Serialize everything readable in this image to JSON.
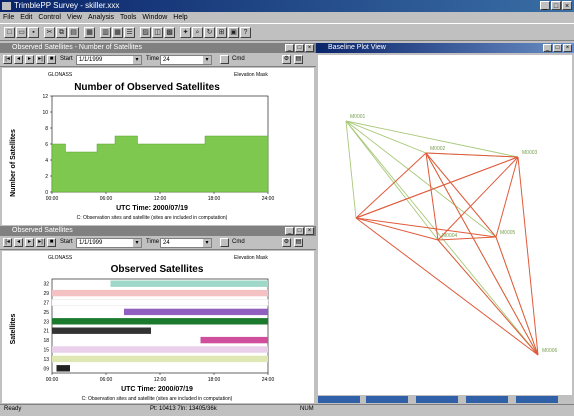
{
  "window": {
    "title": "TrimblePP Survey - skiller.xxx"
  },
  "menu": [
    "File",
    "Edit",
    "Control",
    "View",
    "Analysis",
    "Tools",
    "Window",
    "Help"
  ],
  "panels": {
    "number_panel": {
      "title": "Observed Satellites - Number of Satellites",
      "start_label": "Start",
      "start_value": "1/1/1999",
      "time_label": "Time",
      "time_value": "24",
      "option_label": "Cmd",
      "legend_left": "GLONASS",
      "legend_right": "Elevation Mask",
      "chart_title": "Number of Observed Satellites",
      "ylabel": "Number of Satellites",
      "xlabel": "UTC Time: 2000/07/19",
      "caption": "C: Observation sites and satellite (sites are included in computation)"
    },
    "observed_panel": {
      "title": "Observed Satellites",
      "start_label": "Start",
      "start_value": "1/1/1999",
      "time_label": "Time",
      "time_value": "24",
      "option_label": "Cmd",
      "legend_left": "GLONASS",
      "legend_right": "Elevation Mask",
      "chart_title": "Observed Satellites",
      "ylabel": "Satellites",
      "xlabel": "UTC Time: 2000/07/19",
      "caption": "C: Observation sites and satellite (sites are included in computation)"
    },
    "network_panel": {
      "title": "Baseline Plot View"
    }
  },
  "statusbar": {
    "left": "Ready",
    "mid": "Pt: 10413  7ln: 13405/36k",
    "right": "NUM"
  },
  "chart_data": [
    {
      "type": "area",
      "title": "Number of Observed Satellites",
      "xlabel": "UTC Time: 2000/07/19",
      "ylabel": "Number of Satellites",
      "xticks": [
        "00:00",
        "06:00",
        "12:00",
        "18:00",
        "24:00"
      ],
      "yticks": [
        "0",
        "2",
        "4",
        "6",
        "8",
        "10",
        "12"
      ],
      "ylim": [
        0,
        12
      ],
      "x": [
        0,
        1.5,
        5,
        7,
        9.5,
        13,
        17,
        24
      ],
      "y": [
        6,
        5,
        6,
        7,
        6,
        6,
        7,
        7
      ],
      "color": "#7ec850"
    },
    {
      "type": "bar",
      "title": "Observed Satellites",
      "xlabel": "UTC Time: 2000/07/19",
      "ylabel": "Satellites",
      "xticks": [
        "00:00",
        "06:00",
        "12:00",
        "18:00",
        "24:00"
      ],
      "xlim": [
        0,
        24
      ],
      "rows": [
        {
          "sat": "32",
          "start": 6.5,
          "end": 24,
          "color": "#9fd8c8"
        },
        {
          "sat": "29",
          "start": 0,
          "end": 24,
          "color": "#f4c2c2"
        },
        {
          "sat": "27",
          "start": 0,
          "end": 24,
          "color": "#ffffff"
        },
        {
          "sat": "25",
          "start": 8,
          "end": 24,
          "color": "#9060c0"
        },
        {
          "sat": "23",
          "start": 0,
          "end": 24,
          "color": "#1c7a2e"
        },
        {
          "sat": "21",
          "start": 0,
          "end": 11,
          "color": "#333333"
        },
        {
          "sat": "18",
          "start": 16.5,
          "end": 24,
          "color": "#d04f9c"
        },
        {
          "sat": "15",
          "start": 0,
          "end": 24,
          "color": "#ead0ea"
        },
        {
          "sat": "13",
          "start": 0,
          "end": 24,
          "color": "#dfe8b4"
        },
        {
          "sat": "09",
          "start": 0.5,
          "end": 2,
          "color": "#222222"
        }
      ]
    }
  ],
  "network": {
    "labels": [
      "M0001",
      "M0002",
      "M0003",
      "M0004",
      "M0005",
      "M0006"
    ],
    "colors": {
      "green": "#a8c878",
      "red": "#e05a3a"
    }
  }
}
